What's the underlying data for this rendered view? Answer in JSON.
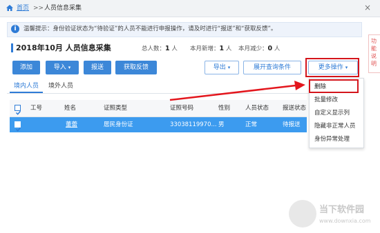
{
  "breadcrumb": {
    "home": "首页",
    "separator": ">>",
    "current": "人员信息采集"
  },
  "window": {
    "close_glyph": "×"
  },
  "notice": {
    "icon": "i",
    "text": "温馨提示：身份验证状态为“待验证”的人员不能进行申报操作，请及时进行“报送”和“获取反馈”。"
  },
  "side_panel": {
    "label": "功能说明"
  },
  "page": {
    "title": "2018年10月  人员信息采集",
    "stats": [
      {
        "label": "总人数：",
        "value": "1",
        "unit": "人"
      },
      {
        "label": "本月新增：",
        "value": "1",
        "unit": "人"
      },
      {
        "label": "本月减少：",
        "value": "0",
        "unit": "人"
      }
    ]
  },
  "toolbar": {
    "add": "添加",
    "import": "导入",
    "submit": "报送",
    "get_feedback": "获取反馈",
    "export": "导出",
    "expand_query": "展开查询条件",
    "more_ops": "更多操作",
    "caret": "▾"
  },
  "tabs": [
    "境内人员",
    "境外人员"
  ],
  "table": {
    "headers": [
      "工号",
      "姓名",
      "证照类型",
      "证照号码",
      "性别",
      "人员状态",
      "报送状态"
    ],
    "rows": [
      {
        "id": "",
        "name": "董蕾",
        "id_type": "居民身份证",
        "id_number": "33038119970...",
        "gender": "男",
        "status": "正常",
        "report_status": "待报送"
      }
    ]
  },
  "more_menu": [
    "删除",
    "批量修改",
    "自定义显示列",
    "隐藏非正常人员",
    "身份异常处理"
  ],
  "watermark": {
    "name": "当下软件园",
    "url": "www.downxia.com"
  },
  "colors": {
    "accent": "#3c87d8",
    "highlight": "#d4141b",
    "row_selected": "#3c9bef"
  }
}
